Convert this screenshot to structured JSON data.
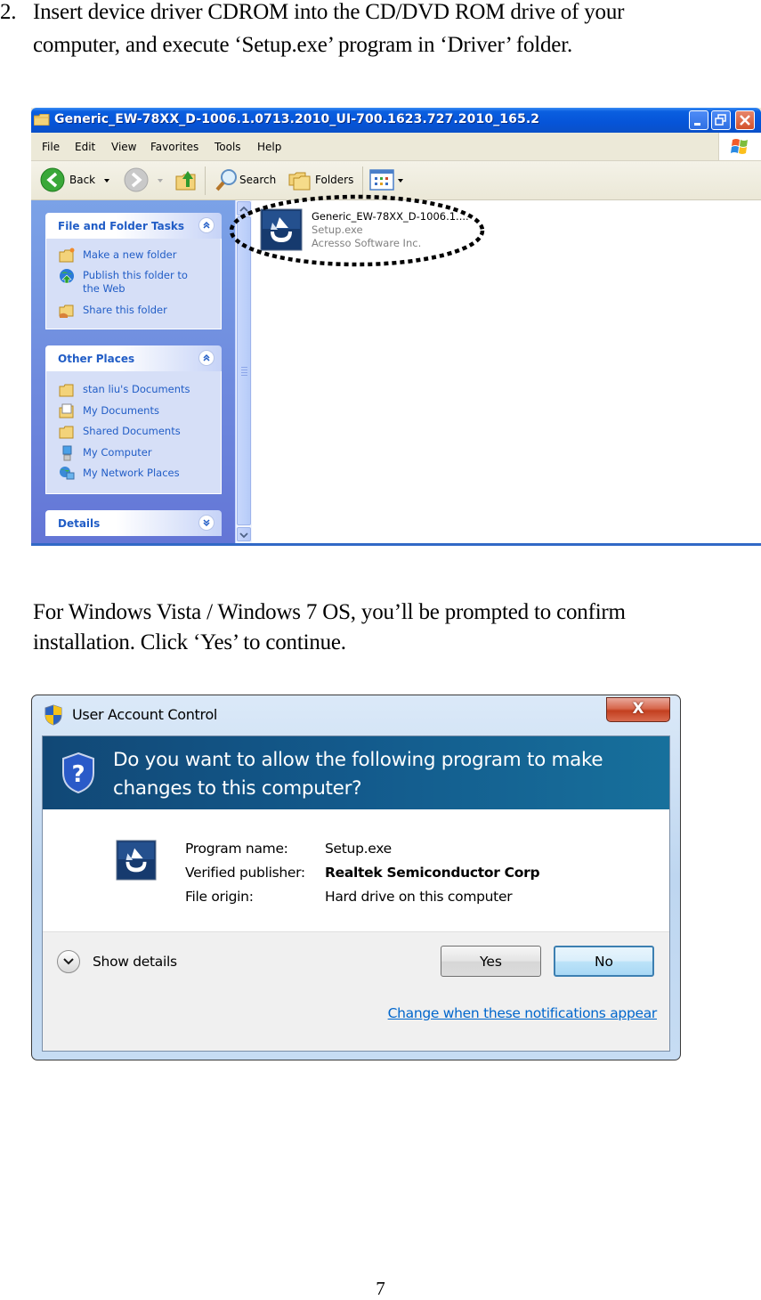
{
  "document": {
    "step_number": "2.",
    "step_lines": [
      "Insert device driver CDROM into the CD/DVD ROM drive of your",
      "computer, and execute ‘Setup.exe’ program in ‘Driver’ folder."
    ],
    "vista_note_lines": [
      "For Windows Vista / Windows 7 OS, you’ll be prompted to confirm",
      "installation. Click ‘Yes’ to continue."
    ],
    "page_number": "7"
  },
  "explorer": {
    "title": "Generic_EW-78XX_D-1006.1.0713.2010_UI-700.1623.727.2010_165.2",
    "menu": [
      "File",
      "Edit",
      "View",
      "Favorites",
      "Tools",
      "Help"
    ],
    "toolbar": {
      "back_label": "Back",
      "search_label": "Search",
      "folders_label": "Folders"
    },
    "panels": {
      "file_folder_tasks": {
        "title": "File and Folder Tasks",
        "items": [
          {
            "label": "Make a new folder",
            "icon": "new-folder-icon"
          },
          {
            "label_lines": [
              "Publish this folder to",
              "the Web"
            ],
            "icon": "publish-web-icon"
          },
          {
            "label": "Share this folder",
            "icon": "share-folder-icon"
          }
        ]
      },
      "other_places": {
        "title": "Other Places",
        "items": [
          {
            "label": "stan liu's Documents",
            "icon": "folder-icon"
          },
          {
            "label": "My Documents",
            "icon": "my-documents-icon"
          },
          {
            "label": "Shared Documents",
            "icon": "folder-icon"
          },
          {
            "label": "My Computer",
            "icon": "my-computer-icon"
          },
          {
            "label": "My Network Places",
            "icon": "network-places-icon"
          }
        ]
      },
      "details": {
        "title": "Details"
      }
    },
    "file": {
      "name": "Generic_EW-78XX_D-1006.1....",
      "type": "Setup.exe",
      "company": "Acresso Software Inc."
    }
  },
  "uac": {
    "title": "User Account Control",
    "close_glyph": "X",
    "question_lines": [
      "Do you want to allow the following program to make",
      "changes to this computer?"
    ],
    "program_name_label": "Program name:",
    "program_name": "Setup.exe",
    "publisher_label": "Verified publisher:",
    "publisher": "Realtek Semiconductor Corp",
    "origin_label": "File origin:",
    "origin": "Hard drive on this computer",
    "show_details_label": "Show details",
    "yes_label": "Yes",
    "no_label": "No",
    "change_link": "Change when these notifications appear"
  }
}
